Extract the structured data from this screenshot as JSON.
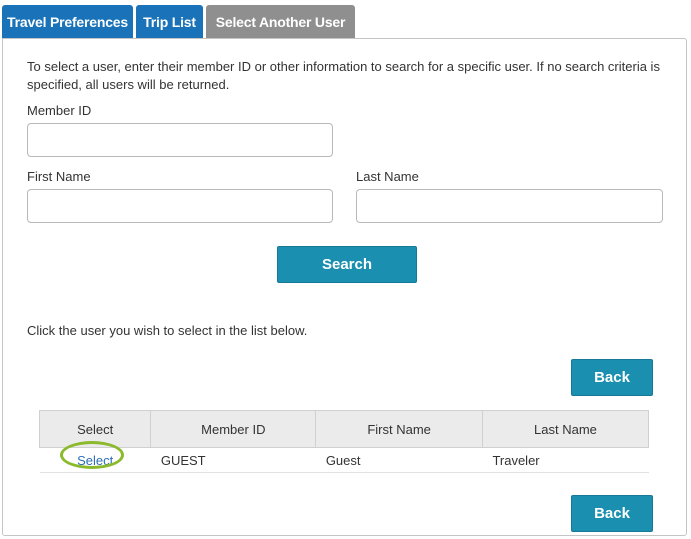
{
  "tabs": [
    {
      "label": "Travel Preferences"
    },
    {
      "label": "Trip List"
    },
    {
      "label": "Select Another User"
    }
  ],
  "intro_text": "To select a user, enter their member ID or other information to search for a specific user.  If no search criteria is specified, all users will be returned.",
  "form": {
    "member_id_label": "Member ID",
    "member_id_value": "",
    "first_name_label": "First Name",
    "first_name_value": "",
    "last_name_label": "Last Name",
    "last_name_value": "",
    "search_label": "Search"
  },
  "list_instruction": "Click the user you wish to select in the list below.",
  "back_label": "Back",
  "table": {
    "columns": [
      "Select",
      "Member ID",
      "First Name",
      "Last Name"
    ],
    "rows": [
      {
        "select": "Select",
        "member_id": "GUEST",
        "first_name": "Guest",
        "last_name": "Traveler"
      }
    ]
  },
  "colors": {
    "tab_blue": "#1a73b8",
    "tab_active": "#8f8f8f",
    "button": "#1a8fb0",
    "highlight_ring": "#8cba2d"
  }
}
